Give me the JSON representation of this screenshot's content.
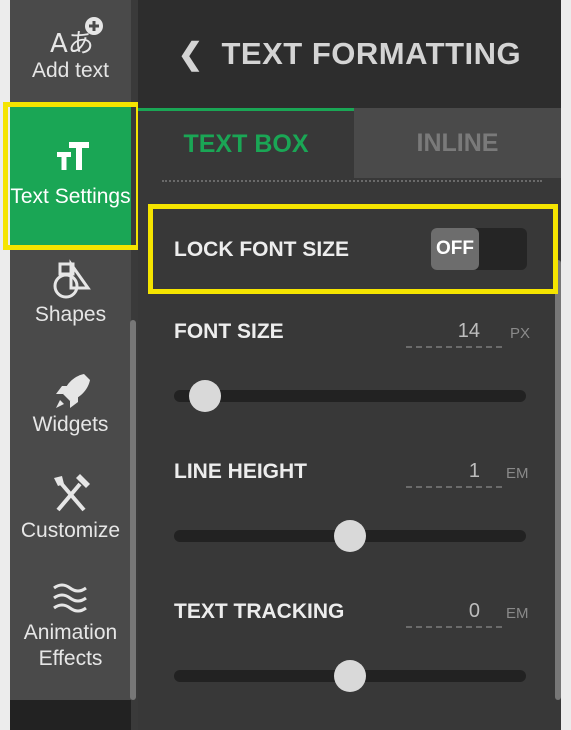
{
  "sidebar": {
    "items": [
      {
        "label": "Add text",
        "icon": "add-text-icon"
      },
      {
        "label": "Text Settings",
        "icon": "text-size-icon"
      },
      {
        "label": "Shapes",
        "icon": "shapes-icon"
      },
      {
        "label": "Widgets",
        "icon": "rocket-icon"
      },
      {
        "label": "Customize",
        "icon": "tools-icon"
      },
      {
        "label": "Animation Effects",
        "icon": "waves-icon"
      }
    ],
    "active_item": "Text Settings"
  },
  "header": {
    "title": "TEXT FORMATTING",
    "back_icon": "chevron-left-icon"
  },
  "tabs": [
    {
      "label": "TEXT BOX",
      "active": true
    },
    {
      "label": "INLINE",
      "active": false
    }
  ],
  "lock_font_size": {
    "label": "LOCK FONT SIZE",
    "toggle_text": "OFF",
    "state": "off"
  },
  "font_size": {
    "label": "FONT SIZE",
    "value": "14",
    "unit": "PX"
  },
  "line_height": {
    "label": "LINE HEIGHT",
    "value": "1",
    "unit": "EM"
  },
  "text_tracking": {
    "label": "TEXT TRACKING",
    "value": "0",
    "unit": "EM"
  },
  "colors": {
    "accent": "#1aa655",
    "highlight": "#f5e400"
  }
}
